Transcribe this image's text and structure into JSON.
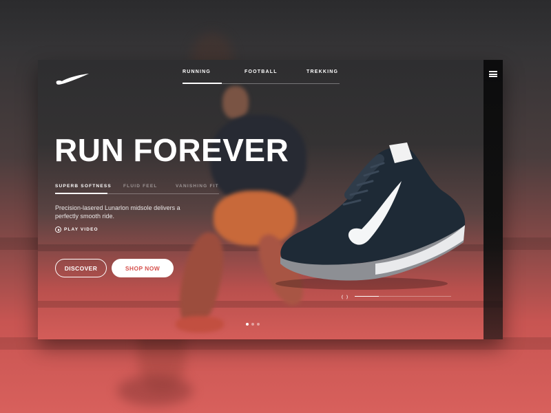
{
  "brand": {
    "logo_icon": "nike-swoosh-icon"
  },
  "nav": {
    "items": [
      {
        "label": "RUNNING",
        "active": true
      },
      {
        "label": "FOOTBALL",
        "active": false
      },
      {
        "label": "TREKKING",
        "active": false
      }
    ],
    "menu_icon": "hamburger-menu-icon"
  },
  "hero": {
    "title": "RUN FOREVER",
    "features": [
      {
        "label": "SUPERB SOFTNESS",
        "active": true
      },
      {
        "label": "FLUID FEEL",
        "active": false
      },
      {
        "label": "VANISHING FIT",
        "active": false
      }
    ],
    "description": "Precision-lasered Lunarlon midsole delivers a perfectly smooth ride.",
    "play_label": "PLAY VIDEO",
    "discover_label": "DISCOVER",
    "shop_label": "SHOP NOW"
  },
  "slider": {
    "progress": 0.25,
    "slide_count": 3,
    "active_slide": 1
  },
  "colors": {
    "accent": "#d6504c",
    "dark": "#2e2e30"
  }
}
